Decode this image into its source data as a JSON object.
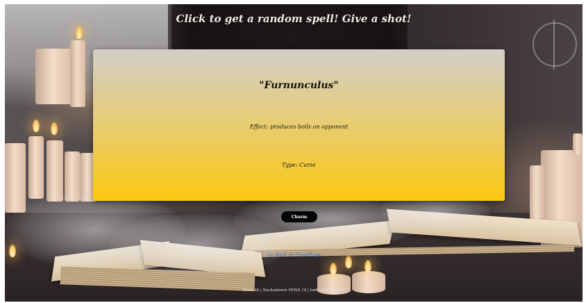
{
  "header": {
    "title": "Click to get a random spell! Give a shot!"
  },
  "spell": {
    "name": "\"Furnunculus\"",
    "effect": "Effect: produces boils on opponent",
    "type": "Type: Curse"
  },
  "actions": {
    "random_button_label": "Charm",
    "back_link_label": "Go Back to FrontPage"
  },
  "footer": {
    "text": "Shan Ali | Nackademin FEND 19 | Individual Project"
  },
  "colors": {
    "card_top": "#d2cec8",
    "card_bottom": "#fbc80f",
    "button_bg": "#060606",
    "link": "#2a6fd6"
  },
  "icons": {
    "background": "candles-and-books-scene"
  }
}
